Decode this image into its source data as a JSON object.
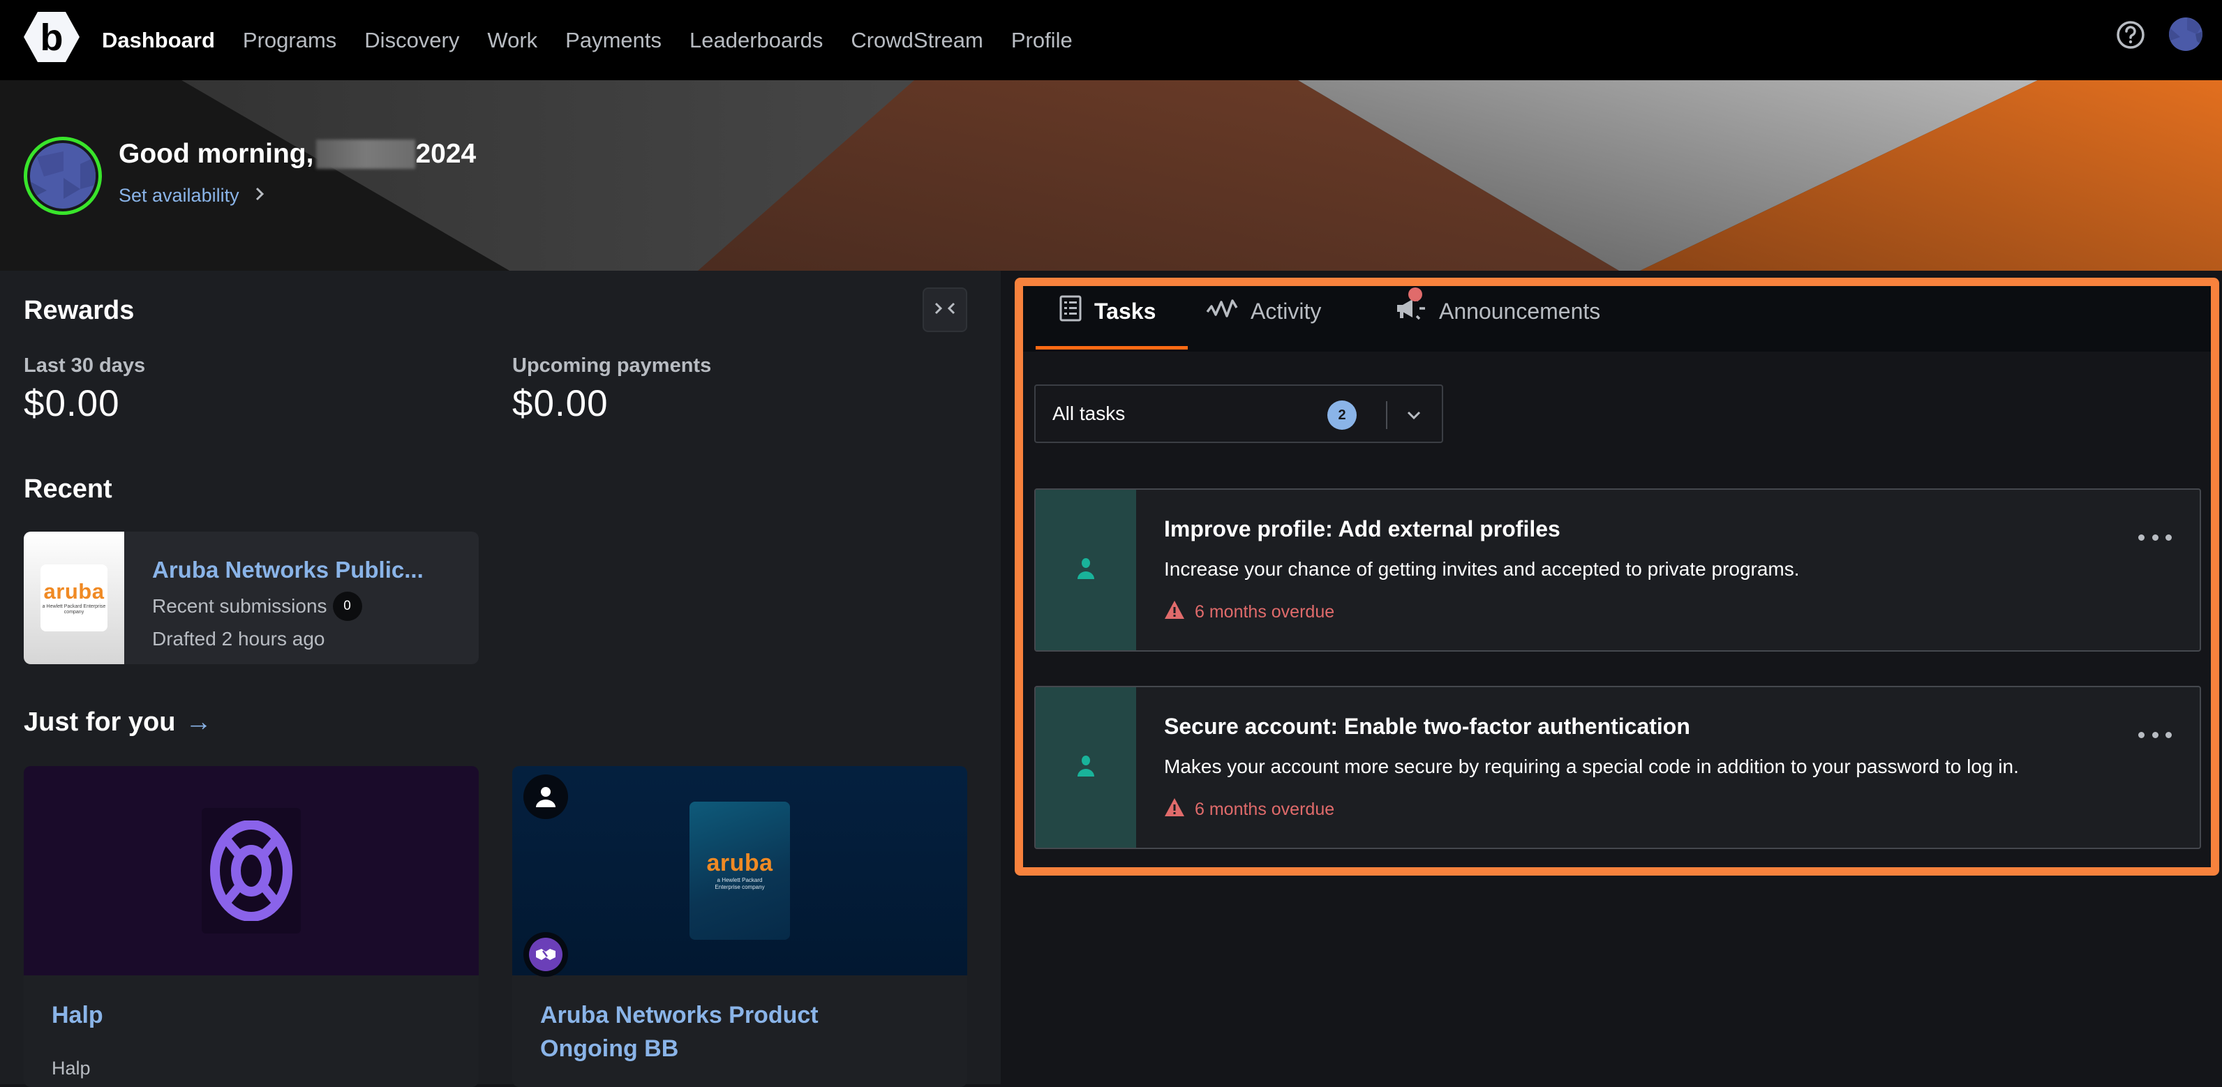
{
  "nav": {
    "logo_letter": "b",
    "items": [
      {
        "label": "Dashboard",
        "active": true
      },
      {
        "label": "Programs",
        "active": false
      },
      {
        "label": "Discovery",
        "active": false
      },
      {
        "label": "Work",
        "active": false
      },
      {
        "label": "Payments",
        "active": false
      },
      {
        "label": "Leaderboards",
        "active": false
      },
      {
        "label": "CrowdStream",
        "active": false
      },
      {
        "label": "Profile",
        "active": false
      }
    ],
    "help_icon": "question-circle-icon",
    "avatar_icon": "user-avatar"
  },
  "hero": {
    "greeting_prefix": "Good morning,",
    "greeting_suffix": "2024",
    "set_availability": "Set availability",
    "availability_color": "#39e52b"
  },
  "rewards": {
    "title": "Rewards",
    "last30_label": "Last 30 days",
    "last30_value": "$0.00",
    "upcoming_label": "Upcoming payments",
    "upcoming_value": "$0.00"
  },
  "recent": {
    "title": "Recent",
    "card": {
      "logo_word": "aruba",
      "logo_sub": "a Hewlett Packard Enterprise company",
      "name": "Aruba Networks Public...",
      "submissions_label": "Recent submissions",
      "submissions_count": "0",
      "drafted": "Drafted 2 hours ago"
    }
  },
  "just_for_you": {
    "title": "Just for you",
    "arrow": "→",
    "cards": [
      {
        "name": "Halp",
        "description": "Halp",
        "icon": "lifebuoy-icon"
      },
      {
        "name": "Aruba Networks Product Ongoing BB",
        "description": "",
        "logo_word": "aruba",
        "logo_sub": "a Hewlett Packard Enterprise company",
        "badges": [
          "person-icon",
          "handshake-icon"
        ]
      }
    ]
  },
  "tasks_panel": {
    "tabs": [
      {
        "label": "Tasks",
        "icon": "list-icon",
        "active": true
      },
      {
        "label": "Activity",
        "icon": "activity-icon",
        "active": false
      },
      {
        "label": "Announcements",
        "icon": "megaphone-icon",
        "active": false,
        "has_notification": true
      }
    ],
    "accent": "#f8823d",
    "filter": {
      "label": "All tasks",
      "count": "2"
    },
    "tasks": [
      {
        "title": "Improve profile: Add external profiles",
        "description": "Increase your chance of getting invites and accepted to private programs.",
        "status": "6 months overdue"
      },
      {
        "title": "Secure account: Enable two-factor authentication",
        "description": "Makes your account more secure by requiring a special code in addition to your password to log in.",
        "status": "6 months overdue"
      }
    ]
  }
}
